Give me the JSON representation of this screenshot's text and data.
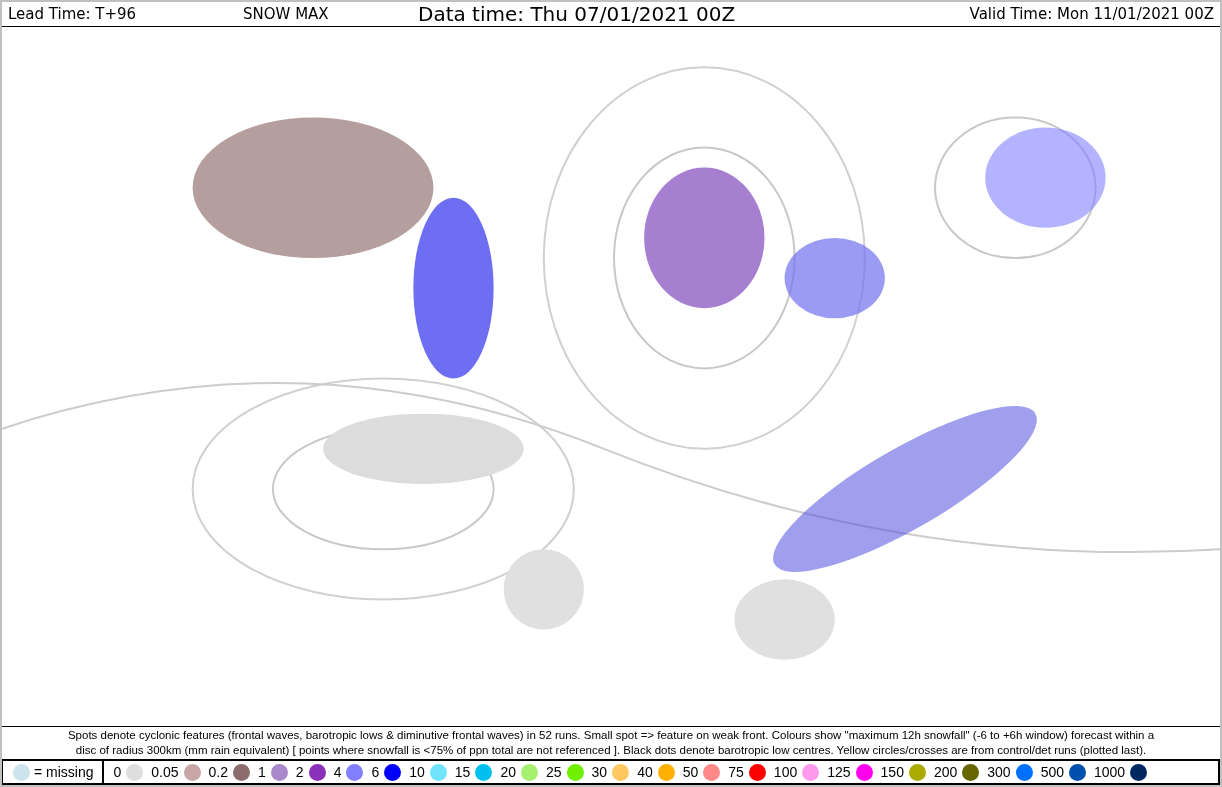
{
  "header": {
    "lead_time": "Lead Time: T+96",
    "product": "SNOW MAX",
    "data_time": "Data time:  Thu 07/01/2021 00Z",
    "valid_time": "Valid Time: Mon 11/01/2021 00Z"
  },
  "caption": [
    "Spots denote cyclonic features (frontal waves, barotropic lows & diminutive frontal waves) in 52 runs. Small spot => feature on weak front. Colours show \"maximum 12h snowfall\" (-6 to +6h window) forecast within a",
    "disc of radius 300km (mm rain equivalent) [ points where snowfall is <75% of ppn total are not referenced ]. Black dots denote barotropic low centres. Yellow circles/crosses are from control/det runs (plotted last)."
  ],
  "legend": {
    "missing": {
      "label": "= missing",
      "color": "#cce4ec"
    },
    "items": [
      {
        "label": "0",
        "color": "#dedede"
      },
      {
        "label": "0.05",
        "color": "#c8a6a6"
      },
      {
        "label": "0.2",
        "color": "#8c6c6c"
      },
      {
        "label": "1",
        "color": "#aa88cc"
      },
      {
        "label": "2",
        "color": "#8a30bb"
      },
      {
        "label": "4",
        "color": "#8080ff"
      },
      {
        "label": "6",
        "color": "#0000ff"
      },
      {
        "label": "10",
        "color": "#70e4ff"
      },
      {
        "label": "15",
        "color": "#00c0f0"
      },
      {
        "label": "20",
        "color": "#a6f070"
      },
      {
        "label": "25",
        "color": "#70f000"
      },
      {
        "label": "30",
        "color": "#ffc860"
      },
      {
        "label": "40",
        "color": "#ffb000"
      },
      {
        "label": "50",
        "color": "#ff8888"
      },
      {
        "label": "75",
        "color": "#ff0000"
      },
      {
        "label": "100",
        "color": "#ff99ee"
      },
      {
        "label": "125",
        "color": "#ff00ee"
      },
      {
        "label": "150",
        "color": "#aaaa00"
      },
      {
        "label": "200",
        "color": "#666600"
      },
      {
        "label": "300",
        "color": "#0070ff"
      },
      {
        "label": "500",
        "color": "#0050b0"
      },
      {
        "label": "1000",
        "color": "#002860"
      }
    ]
  }
}
